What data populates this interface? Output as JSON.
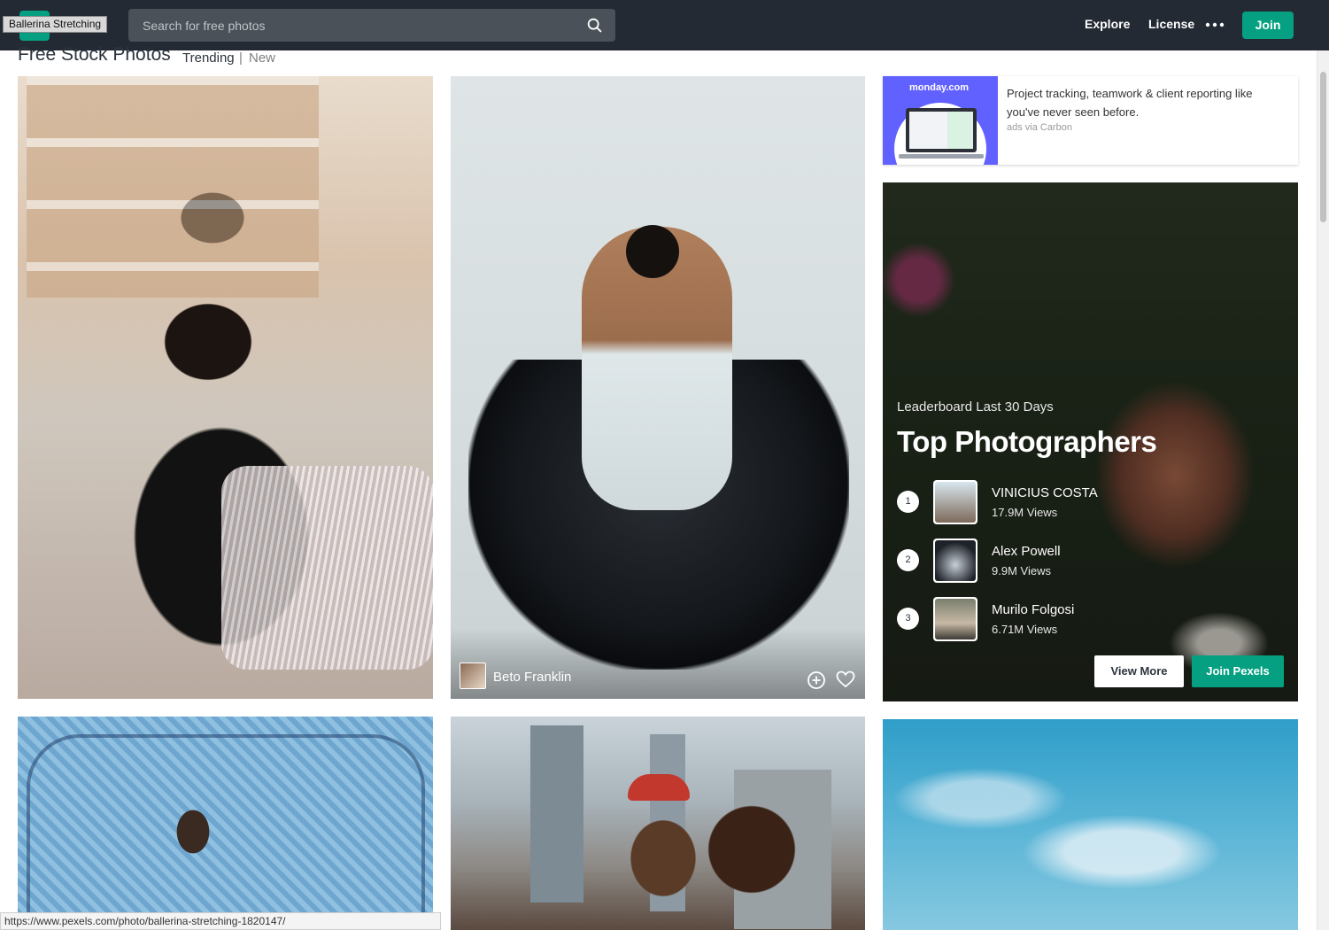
{
  "header": {
    "tooltip": "Ballerina Stretching",
    "search_placeholder": "Search for free photos",
    "nav": {
      "explore": "Explore",
      "license": "License",
      "join": "Join"
    },
    "icons": {
      "search": "search-icon",
      "more": "more-dots-icon"
    }
  },
  "main": {
    "heading": "Free Stock Photos",
    "tabs": {
      "trending": "Trending",
      "separator": "|",
      "new": "New"
    }
  },
  "photos": {
    "featured": {
      "photographer": "Beto Franklin",
      "icons": [
        "add-to-collection-icon",
        "heart-icon"
      ]
    }
  },
  "ad": {
    "brand": "monday.com",
    "text": "Project tracking, teamwork & client reporting like you've never seen before.",
    "via": "ads via Carbon"
  },
  "leaderboard": {
    "subtitle": "Leaderboard Last 30 Days",
    "title": "Top Photographers",
    "entries": [
      {
        "rank": "1",
        "name": "VINICIUS COSTA",
        "views": "17.9M Views"
      },
      {
        "rank": "2",
        "name": "Alex Powell",
        "views": "9.9M Views"
      },
      {
        "rank": "3",
        "name": "Murilo Folgosi",
        "views": "6.71M Views"
      }
    ],
    "view_more": "View More",
    "join_pexels": "Join Pexels"
  },
  "status_url": "https://www.pexels.com/photo/ballerina-stretching-1820147/",
  "colors": {
    "nav_bg": "#232a34",
    "accent": "#05a081",
    "ad_brand": "#6161ff"
  }
}
